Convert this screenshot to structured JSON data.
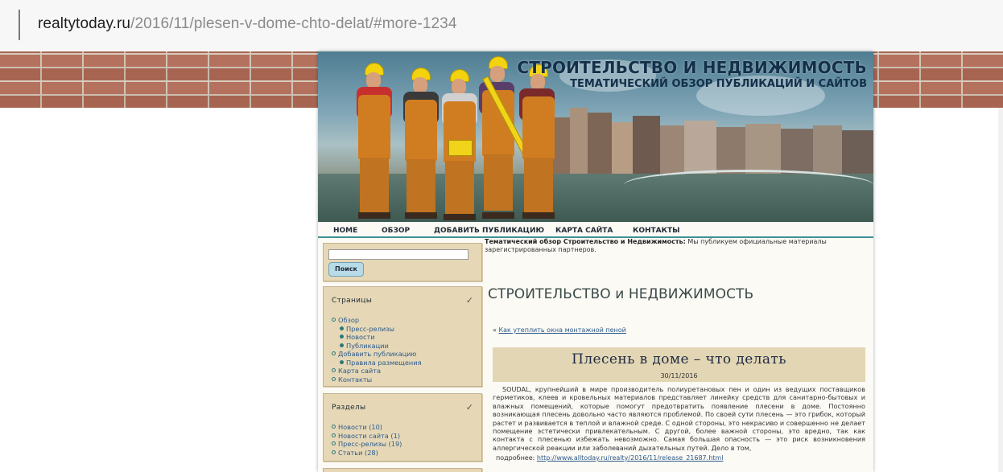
{
  "browser": {
    "url_domain": "realtytoday.ru",
    "url_path": "/2016/11/plesen-v-dome-chto-delat/#more-1234"
  },
  "header": {
    "title": "СТРОИТЕЛЬСТВО И НЕДВИЖИМОСТЬ",
    "subtitle": "ТЕМАТИЧЕСКИЙ ОБЗОР ПУБЛИКАЦИЙ И САЙТОВ"
  },
  "nav": {
    "items": [
      "HOME",
      "ОБЗОР",
      "ДОБАВИТЬ ПУБЛИКАЦИЮ",
      "КАРТА САЙТА",
      "КОНТАКТЫ"
    ]
  },
  "search": {
    "placeholder": "",
    "button_label": "Поиск"
  },
  "pages_widget": {
    "title": "Страницы",
    "items": [
      {
        "label": "Обзор",
        "level": 0
      },
      {
        "label": "Пресс-релизы",
        "level": 1
      },
      {
        "label": "Новости",
        "level": 1
      },
      {
        "label": "Публикации",
        "level": 1
      },
      {
        "label": "Добавить публикацию",
        "level": 0
      },
      {
        "label": "Правила размещения",
        "level": 1
      },
      {
        "label": "Карта сайта",
        "level": 0
      },
      {
        "label": "Контакты",
        "level": 0
      }
    ]
  },
  "categories_widget": {
    "title": "Разделы",
    "items": [
      "Новости (10)",
      "Новости сайта (1)",
      "Пресс-релизы (19)",
      "Статьи (28)"
    ]
  },
  "main": {
    "intro_bold": "Тематический обзор Строительство и Недвижимость:",
    "intro_text": " Мы публикуем официальные материалы зарегистрированных партнеров.",
    "heading": "СТРОИТЕЛЬСТВО и НЕДВИЖИМОСТЬ",
    "prev_arrow": "« ",
    "prev_link": "Как утеплить окна монтажной пеной",
    "post_title": "Плесень в доме – что делать",
    "post_date": "30/11/2016",
    "post_body": "SOUDAL, крупнейший в мире производитель полиуретановых пен и один из ведущих поставщиков герметиков, клеев и кровельных материалов представляет линейку средств для санитарно-бытовых и влажных помещений, которые помогут предотвратить появление плесени в доме.   Постоянно возникающая плесень довольно часто являются проблемой. По своей сути плесень — это грибок, который растет и развивается в теплой и влажной среде. С одной стороны, это некрасиво и совершенно не делает помещение эстетически привлекательным. С другой, более важной стороны, это вредно, так как контакта с плесенью избежать невозможно. Самая большая опасность — это риск возникновения аллергической реакции или заболеваний дыхательных путей. Дело в том,",
    "more_label": "подробнее: ",
    "more_link": "http://www.alltoday.ru/realty/2016/11/release_21687.html"
  },
  "colors": {
    "accent": "#3f8f97",
    "sidebar_box": "#e6d8b7",
    "link": "#2d5a8a"
  }
}
